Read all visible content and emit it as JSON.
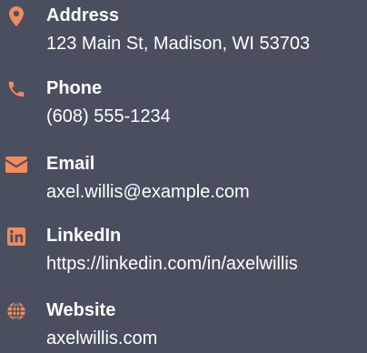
{
  "contact": {
    "items": [
      {
        "icon": "map-pin-icon",
        "label": "Address",
        "value": "123 Main St, Madison, WI 53703"
      },
      {
        "icon": "phone-icon",
        "label": "Phone",
        "value": "(608) 555-1234"
      },
      {
        "icon": "envelope-icon",
        "label": "Email",
        "value": "axel.willis@example.com"
      },
      {
        "icon": "linkedin-icon",
        "label": "LinkedIn",
        "value": "https://linkedin.com/in/axelwillis"
      },
      {
        "icon": "globe-icon",
        "label": "Website",
        "value": "axelwillis.com"
      }
    ]
  },
  "colors": {
    "background": "#4a4f5f",
    "accent": "#f28b5e",
    "text": "#ffffff"
  }
}
